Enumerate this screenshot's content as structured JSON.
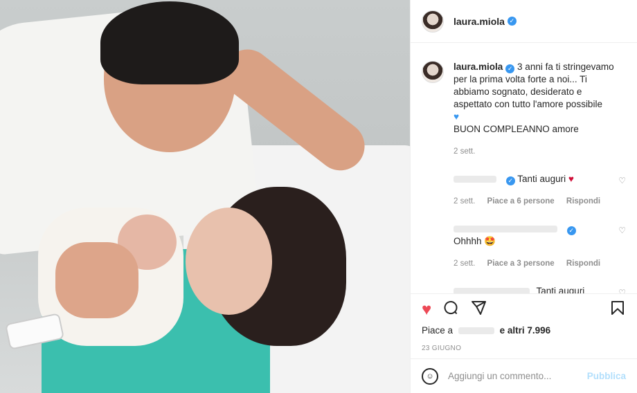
{
  "post": {
    "username": "laura.miola",
    "caption": "3 anni fa ti stringevamo per la prima volta forte a noi... Ti abbiamo sognato, desiderato e aspettato con tutto l'amore possibile",
    "caption_line2": "BUON COMPLEANNO amore",
    "caption_time": "2 sett.",
    "likes_prefix": "Piace a",
    "likes_suffix": "e altri 7.996",
    "date": "23 GIUGNO"
  },
  "comments": [
    {
      "text": "Tanti auguri",
      "time": "2 sett.",
      "likes": "Piace a 6 persone",
      "reply": "Rispondi"
    },
    {
      "text": "Ohhhh",
      "time": "2 sett.",
      "likes": "Piace a 3 persone",
      "reply": "Rispondi"
    },
    {
      "text": "Tanti auguri"
    }
  ],
  "input": {
    "placeholder": "Aggiungi un commento...",
    "publish": "Pubblica"
  },
  "icons": {
    "like": "heart-icon",
    "comment": "comment-icon",
    "share": "send-icon",
    "save": "bookmark-icon",
    "emoji": "emoji-icon"
  },
  "colors": {
    "like_red": "#ed4956",
    "verified_blue": "#3897f0"
  }
}
